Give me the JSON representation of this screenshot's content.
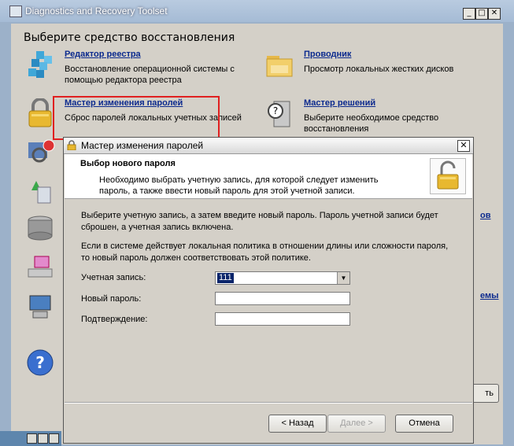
{
  "outer": {
    "title": "Diagnostics and Recovery Toolset",
    "heading": "Выберите средство восстановления",
    "controls": {
      "minimize": "_",
      "maximize": "□",
      "close": "✕"
    }
  },
  "tools": [
    {
      "name": "Редактор реестра",
      "desc": "Восстановление операционной системы с помощью редактора реестра",
      "icon": "registry-icon"
    },
    {
      "name": "Проводник",
      "desc": "Просмотр локальных жестких дисков",
      "icon": "explorer-folder-icon"
    },
    {
      "name": "Мастер изменения паролей",
      "desc": "Сброс паролей локальных учетных записей",
      "icon": "padlock-icon"
    },
    {
      "name": "Мастер решений",
      "desc": "Выберите необходимое средство восстановления",
      "icon": "solution-wizard-icon"
    }
  ],
  "partial": {
    "link1": "ов",
    "link2": "емы",
    "button": "ть"
  },
  "dialog": {
    "title": "Мастер изменения паролей",
    "header_title": "Выбор нового пароля",
    "header_desc": "Необходимо выбрать учетную запись, для которой следует изменить пароль, а также ввести новый пароль для этой учетной записи.",
    "para1": "Выберите учетную запись, а затем введите новый пароль. Пароль учетной записи будет сброшен, а учетная запись включена.",
    "para2": "Если в системе действует локальная политика в отношении длины или сложности пароля, то новый пароль должен соответствовать этой политике.",
    "account_label": "Учетная запись:",
    "account_value": "111",
    "new_password_label": "Новый пароль:",
    "new_password_value": "",
    "confirm_label": "Подтверждение:",
    "confirm_value": "",
    "back_button": "< Назад",
    "next_button": "Далее >",
    "cancel_button": "Отмена"
  },
  "colors": {
    "link": "#0b2a8e",
    "highlight_border": "#e02020",
    "selection": "#0a246a"
  }
}
